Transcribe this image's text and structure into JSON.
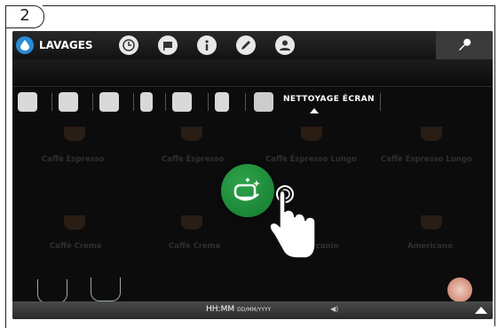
{
  "step": {
    "number": "2"
  },
  "header": {
    "wash_tab": "LAVAGES"
  },
  "subtabs": {
    "screen_cleaning": "NETTOYAGE ÉCRAN"
  },
  "products": [
    {
      "name": "Caffè Espresso"
    },
    {
      "name": "Caffè Espresso"
    },
    {
      "name": "Caffè Espresso Lungo"
    },
    {
      "name": "Caffè Espresso Lungo"
    },
    {
      "name": "Caffè Crema"
    },
    {
      "name": "Caffè Crema"
    },
    {
      "name": "...rcanio"
    },
    {
      "name": "Americano"
    }
  ],
  "footer": {
    "time": "HH:MM",
    "date": "DD/MM/YYYY",
    "volume": "◀)"
  },
  "colors": {
    "accent_green": "#1f8c3b",
    "accent_blue": "#2a8bd6"
  }
}
